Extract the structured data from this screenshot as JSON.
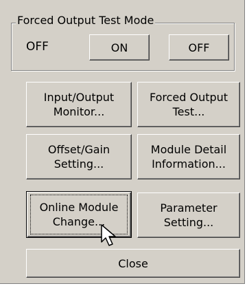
{
  "group": {
    "title": "Forced Output Test Mode",
    "status": "OFF",
    "on_label": "ON",
    "off_label": "OFF"
  },
  "buttons": {
    "io_monitor": "Input/Output\nMonitor...",
    "forced_output_test": "Forced Output\nTest...",
    "offset_gain": "Offset/Gain\nSetting...",
    "module_detail": "Module Detail\nInformation...",
    "online_module_change": "Online Module\nChange...",
    "parameter_setting": "Parameter\nSetting...",
    "close": "Close"
  },
  "colors": {
    "face": "#d4d0c8",
    "shadow": "#808080",
    "highlight": "#ffffff"
  },
  "icons": {
    "cursor": "mouse-pointer-icon"
  }
}
